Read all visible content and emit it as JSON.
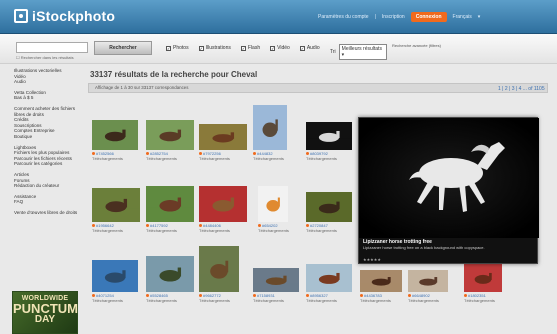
{
  "header": {
    "logo_text": "iStockphoto",
    "link_1": "Paramètres du compte",
    "link_2": "Inscription",
    "connect_label": "Connexion",
    "language": "Français"
  },
  "search": {
    "placeholder": "",
    "scope_label": "Rechercher dans les résultats",
    "button_label": "Rechercher",
    "filters": [
      {
        "label": "Photos"
      },
      {
        "label": "Illustrations"
      },
      {
        "label": "Flash"
      },
      {
        "label": "Vidéo"
      },
      {
        "label": "Audio"
      }
    ],
    "sort_prefix": "Tri",
    "sort_value": "Meilleurs résultats",
    "refine_note": "Recherche avancée (filtres)"
  },
  "sidebar": {
    "groups": [
      [
        "Illustrations vectorielles",
        "Vidéo",
        "Audio"
      ],
      [
        "Vetta Collection",
        "Bas à $ 5"
      ],
      [
        "Comment acheter des fichiers libres de droits",
        "Crédits",
        "Souscriptions",
        "Comptes Entreprise",
        "Boutique"
      ],
      [
        "Lightboxes",
        "Fichiers les plus populaires",
        "Parcourir les fichiers récents",
        "Parcourir les catégories"
      ],
      [
        "Articles",
        "Forums",
        "Rédaction du créateur"
      ],
      [
        "Assistance",
        "FAQ"
      ],
      [
        "Vente d'œuvres libres de droits"
      ]
    ]
  },
  "promo": {
    "line1": "WORLDWIDE",
    "line2": "PUNCTUM",
    "line3": "DAY"
  },
  "main": {
    "title": "33137 résultats de la recherche pour Cheval",
    "results_info": "Affichage de 1 à 30 sur 33137 correspondances",
    "pagination": "1 | 2 | 3 | 4 ... of 1105"
  },
  "thumbs": [
    {
      "id": "#7452566",
      "downloads": "Téléchargements"
    },
    {
      "id": "#2852754",
      "downloads": "Téléchargements"
    },
    {
      "id": "#7972256",
      "downloads": "Téléchargements"
    },
    {
      "id": "#444832",
      "downloads": "Téléchargements"
    },
    {
      "id": "#8039792",
      "downloads": "Téléchargements"
    },
    {
      "id": "#1956642",
      "downloads": "Téléchargements"
    },
    {
      "id": "#4177592",
      "downloads": "Téléchargements"
    },
    {
      "id": "#4484406",
      "downloads": "Téléchargements"
    },
    {
      "id": "#654202",
      "downloads": "Téléchargements"
    },
    {
      "id": "#2720847",
      "downloads": "Téléchargements"
    },
    {
      "id": "#4071254",
      "downloads": "Téléchargements"
    },
    {
      "id": "#5528465",
      "downloads": "Téléchargements"
    },
    {
      "id": "#9662772",
      "downloads": "Téléchargements"
    },
    {
      "id": "#7158931",
      "downloads": "Téléchargements"
    },
    {
      "id": "#8956327",
      "downloads": "Téléchargements"
    },
    {
      "id": "#4436783",
      "downloads": "Téléchargements"
    },
    {
      "id": "#6648902",
      "downloads": "Téléchargements"
    },
    {
      "id": "#1802351",
      "downloads": "Téléchargements"
    }
  ],
  "preview": {
    "title": "Lipizzaner horse trotting free",
    "description": "Lipizzaner horse trotting free on a black background with copyspace.",
    "rating": "★★★★★"
  },
  "colors": {
    "header_blue": "#2e6f9e",
    "connect_orange": "#f06a1d",
    "link_blue": "#3a6fb0",
    "promo_green": "#2b4a1d"
  }
}
